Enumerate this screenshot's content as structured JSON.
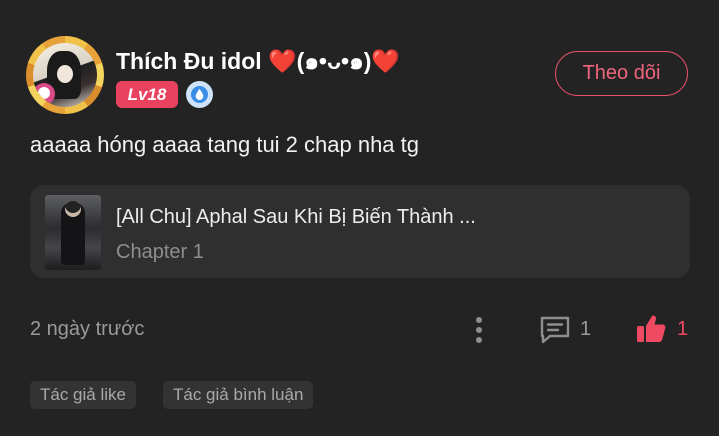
{
  "user": {
    "name": "Thích Đu idol ❤️(๑•ᴗ•๑)❤️",
    "level": "Lv18",
    "follow_label": "Theo dõi"
  },
  "comment": {
    "text": "aaaaa hóng aaaa tang tui 2 chap nha tg"
  },
  "story": {
    "title": "[All Chu] Aphal Sau Khi Bị Biến Thành ...",
    "chapter": "Chapter 1"
  },
  "meta": {
    "timestamp": "2 ngày trước",
    "reply_count": "1",
    "like_count": "1"
  },
  "tags": [
    "Tác giả like",
    "Tác giả bình luận"
  ],
  "colors": {
    "background": "#232323",
    "card": "#2f2f2f",
    "accent": "#e8425f",
    "muted_text": "#9a9a9a"
  },
  "icons": {
    "verify": "verified-droplet-icon",
    "more": "more-vertical-icon",
    "reply": "comment-bubble-icon",
    "like": "thumbs-up-icon"
  }
}
